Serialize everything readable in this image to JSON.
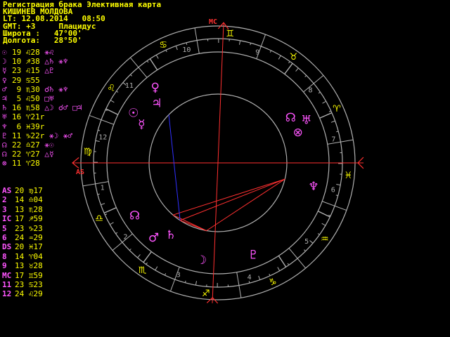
{
  "header": {
    "line1": "Регистрация брака Элективная карта",
    "line2": "КИШИНЕВ МОЛДОВА",
    "line3": "LT: 12.08.2014   08:50",
    "line4": "GMT: +3     Плацидус",
    "line5": "Широта :   47°00'",
    "line6": "Долгота:   28°50'"
  },
  "planets": [
    {
      "sym": "☉",
      "pos": "19 ♌28",
      "asp": "⚹♌"
    },
    {
      "sym": "☽",
      "pos": "10 ♐38",
      "asp": "△♄ ⚹♆"
    },
    {
      "sym": "☿",
      "pos": "23 ♌15",
      "asp": "△♇"
    },
    {
      "sym": "♀",
      "pos": "29 ♋55",
      "asp": ""
    },
    {
      "sym": "♂",
      "pos": " 9 ♏30",
      "asp": "☌♄ ⚹♆"
    },
    {
      "sym": "♃",
      "pos": " 5 ♌50",
      "asp": "□♅"
    },
    {
      "sym": "♄",
      "pos": "16 ♏58",
      "asp": "△☽ ☌♂ □♃"
    },
    {
      "sym": "♅",
      "pos": "16 ♈21r",
      "asp": ""
    },
    {
      "sym": "♆",
      "pos": " 6 ♓39r",
      "asp": ""
    },
    {
      "sym": "♇",
      "pos": "11 ♑22r",
      "asp": "⚹☽ ⚹♂"
    },
    {
      "sym": "☊",
      "pos": "22 ♎27",
      "asp": "⚹☉"
    },
    {
      "sym": "☊",
      "pos": "22 ♈27",
      "asp": "△☿"
    },
    {
      "sym": "⊗",
      "pos": "11 ♈28",
      "asp": ""
    }
  ],
  "houses": [
    {
      "name": "AS",
      "pos": "20 ♍17"
    },
    {
      "name": "2",
      "pos": "14 ♎04"
    },
    {
      "name": "3",
      "pos": "13 ♏28"
    },
    {
      "name": "IC",
      "pos": "17 ♐59"
    },
    {
      "name": "5",
      "pos": "23 ♑23"
    },
    {
      "name": "6",
      "pos": "24 ♒29"
    },
    {
      "name": "DS",
      "pos": "20 ♓17"
    },
    {
      "name": "8",
      "pos": "14 ♈04"
    },
    {
      "name": "9",
      "pos": "13 ♉28"
    },
    {
      "name": "MC",
      "pos": "17 ♊59"
    },
    {
      "name": "11",
      "pos": "23 ♋23"
    },
    {
      "name": "12",
      "pos": "24 ♌29"
    }
  ],
  "wheel": {
    "asc_label": "AS",
    "mc_label": "MC",
    "ascendant_deg": 170.28,
    "colors": {
      "ring": "#b0b0b0",
      "axis": "#ff3030",
      "blue": "#3030ff",
      "signs": "#ffff00",
      "planets": "#ff55ff",
      "house_num": "#b0b0b0"
    },
    "house_cusps_deg": [
      170.28,
      194.07,
      223.47,
      257.98,
      293.38,
      324.48,
      350.28,
      14.07,
      43.47,
      77.98,
      113.38,
      144.48
    ],
    "house_numbers": [
      "1",
      "2",
      "3",
      "4",
      "5",
      "6",
      "7",
      "8",
      "9",
      "10",
      "11",
      "12"
    ],
    "signs": [
      "♈",
      "♉",
      "♊",
      "♋",
      "♌",
      "♍",
      "♎",
      "♏",
      "♐",
      "♑",
      "♒",
      "♓"
    ],
    "planet_glyphs": [
      {
        "g": "☉",
        "lon": 139.47
      },
      {
        "g": "☽",
        "lon": 250.63
      },
      {
        "g": "☿",
        "lon": 143.25
      },
      {
        "g": "♀",
        "lon": 119.92
      },
      {
        "g": "♂",
        "lon": 219.5
      },
      {
        "g": "♃",
        "lon": 125.83
      },
      {
        "g": "♄",
        "lon": 226.97
      },
      {
        "g": "♅",
        "lon": 16.35
      },
      {
        "g": "♆",
        "lon": 336.65
      },
      {
        "g": "♇",
        "lon": 281.37
      },
      {
        "g": "☊",
        "lon": 202.45
      },
      {
        "g": "☊",
        "lon": 22.45
      },
      {
        "g": "⊗",
        "lon": 11.47
      }
    ],
    "aspect_lines": [
      [
        250.63,
        219.5
      ],
      [
        250.63,
        226.97
      ],
      [
        219.5,
        336.65
      ],
      [
        226.97,
        336.65
      ],
      [
        250.63,
        336.65
      ]
    ],
    "blue_lines": [
      [
        125.83,
        226.97
      ]
    ]
  }
}
